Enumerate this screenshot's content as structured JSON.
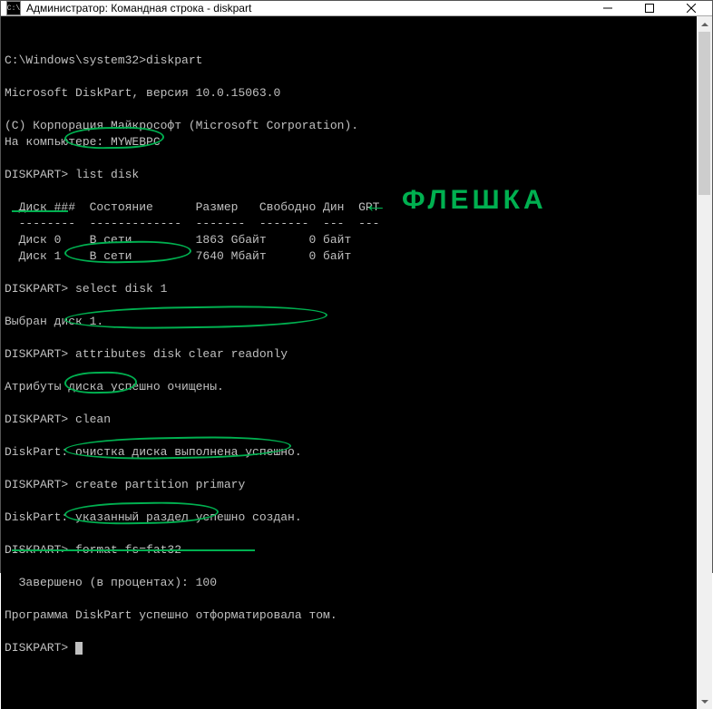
{
  "window": {
    "title": "Администратор: Командная строка - diskpart",
    "icon_label": "cmd"
  },
  "terminal": {
    "lines": [
      "C:\\Windows\\system32>diskpart",
      "",
      "Microsoft DiskPart, версия 10.0.15063.0",
      "",
      "(C) Корпорация Майкрософт (Microsoft Corporation).",
      "На компьютере: MYWEBPC",
      "",
      "DISKPART> list disk",
      "",
      "  Диск ###  Состояние      Размер   Свободно Дин  GPT",
      "  --------  -------------  -------  -------  ---  ---",
      "  Диск 0    В сети         1863 Gбайт      0 байт",
      "  Диск 1    В сети         7640 Mбайт      0 байт",
      "",
      "DISKPART> select disk 1",
      "",
      "Выбран диск 1.",
      "",
      "DISKPART> attributes disk clear readonly",
      "",
      "Атрибуты диска успешно очищены.",
      "",
      "DISKPART> clean",
      "",
      "DiskPart: очистка диска выполнена успешно.",
      "",
      "DISKPART> create partition primary",
      "",
      "DiskPart: указанный раздел успешно создан.",
      "",
      "DISKPART> format fs=fat32",
      "",
      "  Завершено (в процентах): 100",
      "",
      "Программа DiskPart успешно отформатировала том.",
      "",
      "DISKPART> "
    ]
  },
  "annotations": {
    "arrow": "←",
    "flash_label": "ФЛЕШКА"
  }
}
